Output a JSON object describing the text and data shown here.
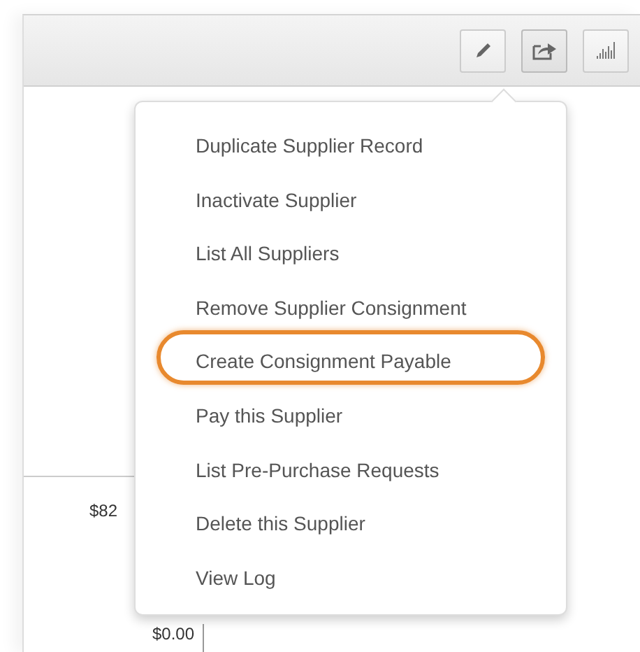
{
  "toolbar": {
    "buttons": [
      {
        "kind": "edit",
        "selected": false
      },
      {
        "kind": "share",
        "selected": true
      },
      {
        "kind": "chart",
        "selected": false
      }
    ]
  },
  "background": {
    "amount": "$82",
    "total": "$0.00"
  },
  "menu": {
    "items": [
      {
        "label": "Duplicate Supplier Record",
        "highlighted": false
      },
      {
        "label": "Inactivate Supplier",
        "highlighted": false
      },
      {
        "label": "List All Suppliers",
        "highlighted": false
      },
      {
        "label": "Remove Supplier Consignment",
        "highlighted": false
      },
      {
        "label": "Create Consignment Payable",
        "highlighted": true
      },
      {
        "label": "Pay this Supplier",
        "highlighted": false
      },
      {
        "label": "List Pre-Purchase Requests",
        "highlighted": false
      },
      {
        "label": "Delete this Supplier",
        "highlighted": false
      },
      {
        "label": "View Log",
        "highlighted": false
      }
    ]
  }
}
